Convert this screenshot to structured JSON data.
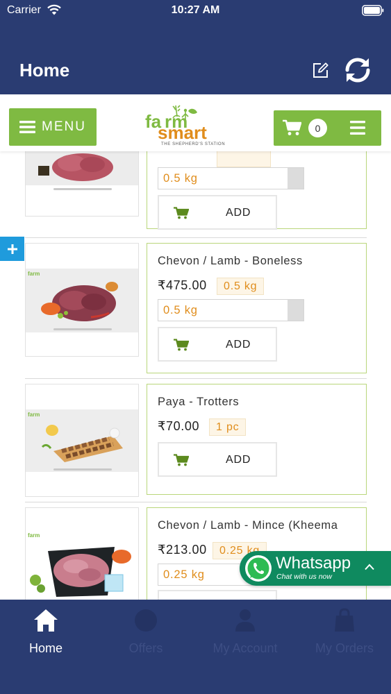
{
  "status_bar": {
    "carrier": "Carrier",
    "time": "10:27 AM"
  },
  "nav": {
    "title": "Home"
  },
  "header": {
    "menu_label": "MENU",
    "logo_text": "farm smart",
    "logo_tagline": "THE SHEPHERD'S STATION",
    "cart_count": "0"
  },
  "products": [
    {
      "name": "",
      "price": "",
      "unit": "",
      "quantity": "0.5 kg",
      "add_label": "ADD"
    },
    {
      "name": "Chevon / Lamb - Boneless",
      "price": "₹475.00",
      "unit": "0.5 kg",
      "quantity": "0.5 kg",
      "add_label": "ADD"
    },
    {
      "name": "Paya - Trotters",
      "price": "₹70.00",
      "unit": "1 pc",
      "quantity": "",
      "add_label": "ADD"
    },
    {
      "name": "Chevon / Lamb - Mince (Kheema",
      "price": "₹213.00",
      "unit": "0.25 kg",
      "quantity": "0.25 kg",
      "add_label": "ADD"
    }
  ],
  "whatsapp": {
    "title": "Whatsapp",
    "subtitle": "Chat with us now"
  },
  "tabs": [
    {
      "label": "Home",
      "icon": "home-icon",
      "active": true
    },
    {
      "label": "Offers",
      "icon": "offers-icon",
      "active": false
    },
    {
      "label": "My Account",
      "icon": "account-icon",
      "active": false
    },
    {
      "label": "My Orders",
      "icon": "orders-icon",
      "active": false
    }
  ],
  "colors": {
    "nav": "#2a3c72",
    "accent_green": "#7fba42",
    "price_orange": "#e08d1c",
    "whatsapp": "#0f8a5f",
    "expand_tab": "#1f9bdc"
  }
}
